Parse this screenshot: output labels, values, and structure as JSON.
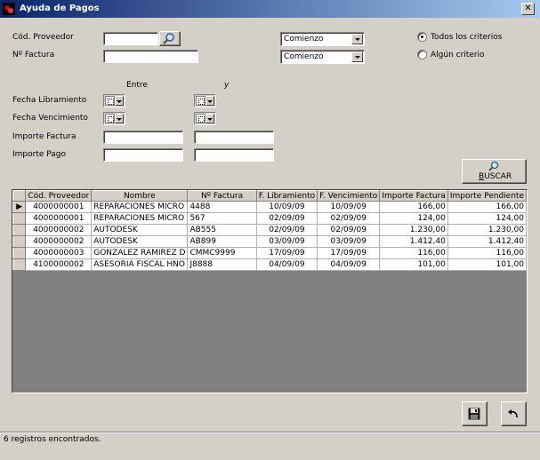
{
  "window": {
    "title": "Ayuda de Pagos",
    "close_label": "✕"
  },
  "form": {
    "cod_proveedor_label": "Cód. Proveedor",
    "cod_proveedor_value": "",
    "factura_label": "Nº Factura",
    "factura_value": "",
    "combo1_value": "Comienzo",
    "combo2_value": "Comienzo",
    "entre_label": "Entre",
    "y_label": "y",
    "fecha_libramiento_label": "Fecha Libramiento",
    "fecha_vencimiento_label": "Fecha Vencimiento",
    "importe_factura_label": "Importe Factura",
    "importe_pago_label": "Importe Pago",
    "importe_factura_from": "",
    "importe_factura_to": "",
    "importe_pago_from": "",
    "importe_pago_to": ""
  },
  "criteria": {
    "todos_label": "Todos los criterios",
    "algun_label": "Algún criterio",
    "selected": "todos"
  },
  "buscar_button": {
    "label_first": "B",
    "label_rest": "USCAR"
  },
  "grid": {
    "columns": [
      "Cód. Proveedor",
      "Nombre",
      "Nº Factura",
      "F. Libramiento",
      "F. Vencimiento",
      "Importe Factura",
      "Importe Pendiente"
    ],
    "rows": [
      [
        "4000000001",
        "REPARACIONES MICRO",
        "4488",
        "10/09/09",
        "10/09/09",
        "166,00",
        "166,00"
      ],
      [
        "4000000001",
        "REPARACIONES MICRO",
        "567",
        "02/09/09",
        "02/09/09",
        "124,00",
        "124,00"
      ],
      [
        "4000000002",
        "AUTODESK",
        "AB555",
        "02/09/09",
        "02/09/09",
        "1.230,00",
        "1.230,00"
      ],
      [
        "4000000002",
        "AUTODESK",
        "AB899",
        "03/09/09",
        "03/09/09",
        "1.412,40",
        "1.412,40"
      ],
      [
        "4000000003",
        "GONZALEZ RAMIREZ D",
        "CMMC9999",
        "17/09/09",
        "17/09/09",
        "116,00",
        "116,00"
      ],
      [
        "4100000002",
        "ASESORIA FISCAL HNO",
        "J8888",
        "04/09/09",
        "04/09/09",
        "101,00",
        "101,00"
      ]
    ],
    "current_row_indicator": "▶"
  },
  "bottom_buttons": {
    "save_icon": "floppy-disk-icon",
    "undo_icon": "undo-arrow-icon"
  },
  "status": {
    "text": "6 registros encontrados."
  },
  "colors": {
    "title_start": "#0a246a",
    "title_end": "#a6caf0",
    "face": "#d4d0c8"
  }
}
